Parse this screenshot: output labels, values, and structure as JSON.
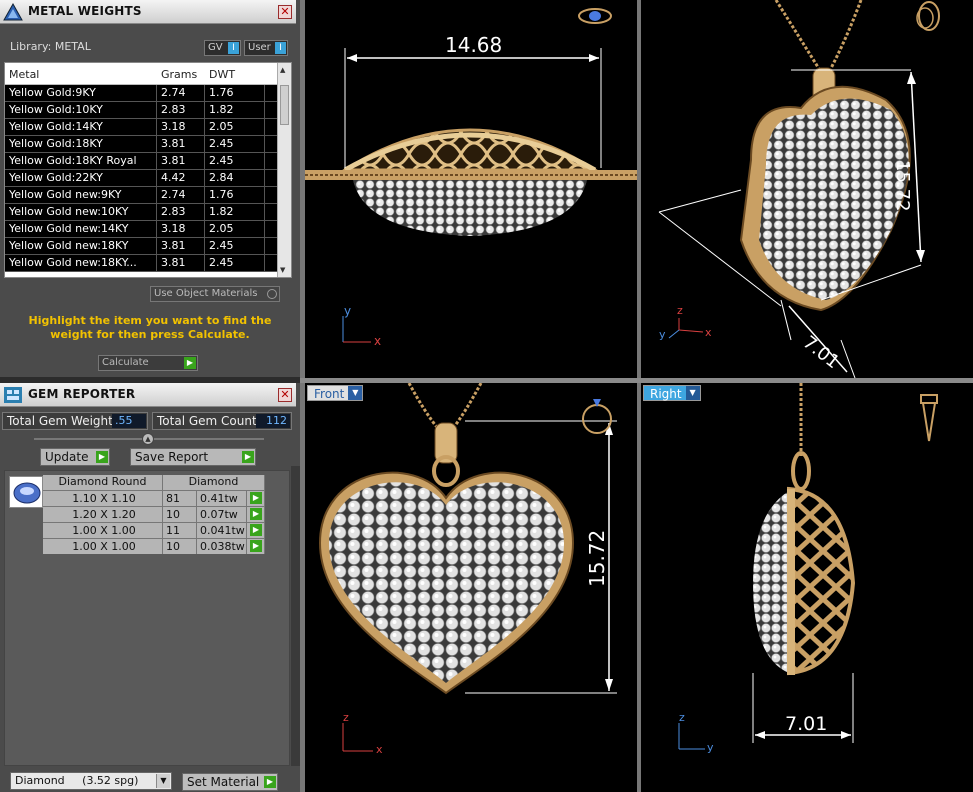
{
  "metal_panel": {
    "title": "METAL WEIGHTS",
    "library_label": "Library: METAL",
    "gv_label": "GV",
    "user_label": "User",
    "columns": [
      "Metal",
      "Grams",
      "DWT"
    ],
    "rows": [
      [
        "Yellow Gold:9KY",
        "2.74",
        "1.76"
      ],
      [
        "Yellow Gold:10KY",
        "2.83",
        "1.82"
      ],
      [
        "Yellow Gold:14KY",
        "3.18",
        "2.05"
      ],
      [
        "Yellow Gold:18KY",
        "3.81",
        "2.45"
      ],
      [
        "Yellow Gold:18KY Royal",
        "3.81",
        "2.45"
      ],
      [
        "Yellow Gold:22KY",
        "4.42",
        "2.84"
      ],
      [
        "Yellow Gold new:9KY",
        "2.74",
        "1.76"
      ],
      [
        "Yellow Gold new:10KY",
        "2.83",
        "1.82"
      ],
      [
        "Yellow Gold new:14KY",
        "3.18",
        "2.05"
      ],
      [
        "Yellow Gold new:18KY",
        "3.81",
        "2.45"
      ],
      [
        "Yellow Gold new:18KY...",
        "3.81",
        "2.45"
      ]
    ],
    "use_object_materials": "Use Object Materials",
    "hint": "Highlight the item you want to find the weight for then press Calculate.",
    "calculate_label": "Calculate"
  },
  "gem_panel": {
    "title": "GEM REPORTER",
    "total_weight_label": "Total Gem Weight",
    "total_weight_value": ".55",
    "total_count_label": "Total Gem Count",
    "total_count_value": "112",
    "update_label": "Update",
    "save_report_label": "Save Report",
    "columns": [
      "Diamond Round",
      "Diamond"
    ],
    "rows": [
      [
        "1.10 X 1.10",
        "81",
        "0.41tw"
      ],
      [
        "1.20 X 1.20",
        "10",
        "0.07tw"
      ],
      [
        "1.00 X 1.00",
        "11",
        "0.041tw"
      ],
      [
        "1.00 X 1.00",
        "10",
        "0.038tw"
      ]
    ]
  },
  "footer": {
    "material_select": "Diamond     (3.52 spg)",
    "set_material_label": "Set Material"
  },
  "viewports": {
    "top": {
      "dimension": "14.68"
    },
    "perspective": {
      "dim_height": "15.72",
      "dim_depth": "7.01"
    },
    "front": {
      "label": "Front",
      "dimension": "15.72"
    },
    "right": {
      "label": "Right",
      "dimension": "7.01"
    }
  },
  "axes": {
    "x": "x",
    "y": "y",
    "z": "z"
  },
  "colors": {
    "gold": "#c9a064",
    "accent": "#3ea6e0",
    "hint_text": "#f2c200",
    "go_button": "#39a41c"
  }
}
